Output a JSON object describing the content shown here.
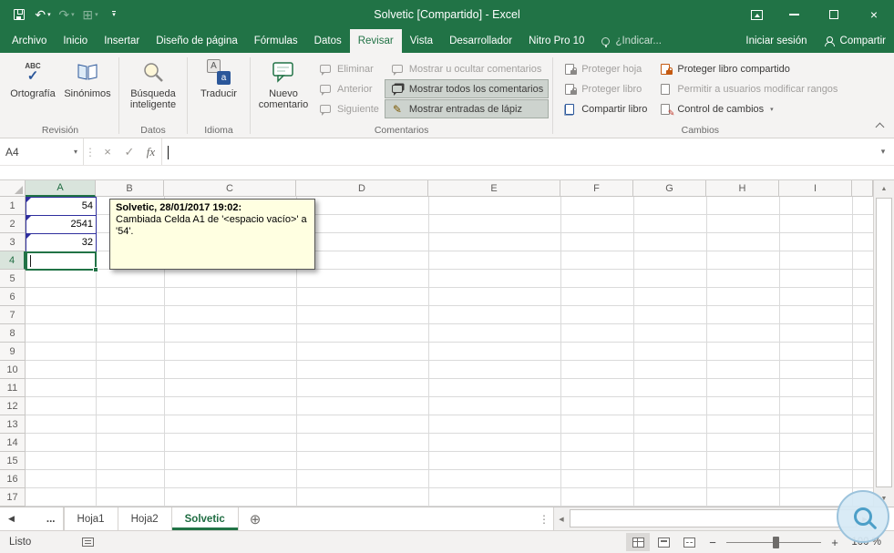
{
  "titlebar": {
    "title": "Solvetic  [Compartido] - Excel"
  },
  "icons": {
    "undo": "↶",
    "redo": "↷",
    "dropdown": "▾",
    "close": "×",
    "qat_extra": "⊞",
    "ellipsis_v": "⋮",
    "cancel": "×",
    "accept": "✓",
    "fx": "fx",
    "abc": "ABC",
    "check": "✓",
    "pencil": "✎",
    "translate_front": "a",
    "translate_back": "A",
    "up": "▲",
    "down": "▼",
    "left": "◀",
    "right": "▶",
    "add_sheet": "⊕",
    "zoom_out": "−",
    "zoom_in": "+"
  },
  "ribbon": {
    "tabs": [
      "Archivo",
      "Inicio",
      "Insertar",
      "Diseño de página",
      "Fórmulas",
      "Datos",
      "Revisar",
      "Vista",
      "Desarrollador",
      "Nitro Pro 10"
    ],
    "active_tab": "Revisar",
    "tellme": "¿Indicar...",
    "signin": "Iniciar sesión",
    "share": "Compartir",
    "groups": {
      "revision": {
        "label": "Revisión",
        "spelling": "Ortografía",
        "thesaurus": "Sinónimos"
      },
      "datos": {
        "label": "Datos",
        "smart_lookup": "Búsqueda inteligente"
      },
      "idioma": {
        "label": "Idioma",
        "translate": "Traducir"
      },
      "comentarios": {
        "label": "Comentarios",
        "new_comment": "Nuevo comentario",
        "delete": "Eliminar",
        "previous": "Anterior",
        "next": "Siguiente",
        "show_hide": "Mostrar u ocultar comentarios",
        "show_all": "Mostrar todos los comentarios",
        "show_ink": "Mostrar entradas de lápiz"
      },
      "cambios": {
        "label": "Cambios",
        "protect_sheet": "Proteger hoja",
        "protect_book": "Proteger libro",
        "share_book": "Compartir libro",
        "protect_shared": "Proteger libro compartido",
        "allow_ranges": "Permitir a usuarios modificar rangos",
        "track_changes": "Control de cambios"
      }
    }
  },
  "formula_bar": {
    "name_box": "A4"
  },
  "grid": {
    "columns": [
      "A",
      "B",
      "C",
      "D",
      "E",
      "F",
      "G",
      "H",
      "I"
    ],
    "rows": [
      "1",
      "2",
      "3",
      "4",
      "5",
      "6",
      "7",
      "8",
      "9",
      "10",
      "11",
      "12",
      "13",
      "14",
      "15",
      "16",
      "17"
    ],
    "cells": {
      "A1": "54",
      "A2": "2541",
      "A3": "32"
    },
    "active_cell": "A4"
  },
  "comment": {
    "author_line": "Solvetic, 28/01/2017 19:02:",
    "body": "Cambiada Celda A1 de '<espacio vacío>' a '54'."
  },
  "sheetbar": {
    "more": "...",
    "tabs": [
      "Hoja1",
      "Hoja2",
      "Solvetic"
    ],
    "active_tab": "Solvetic"
  },
  "status": {
    "mode": "Listo",
    "zoom": "100 %"
  },
  "colors": {
    "excel_green": "#217346",
    "comment_bg": "#FFFFE1",
    "change_border": "#2F2F9E"
  }
}
